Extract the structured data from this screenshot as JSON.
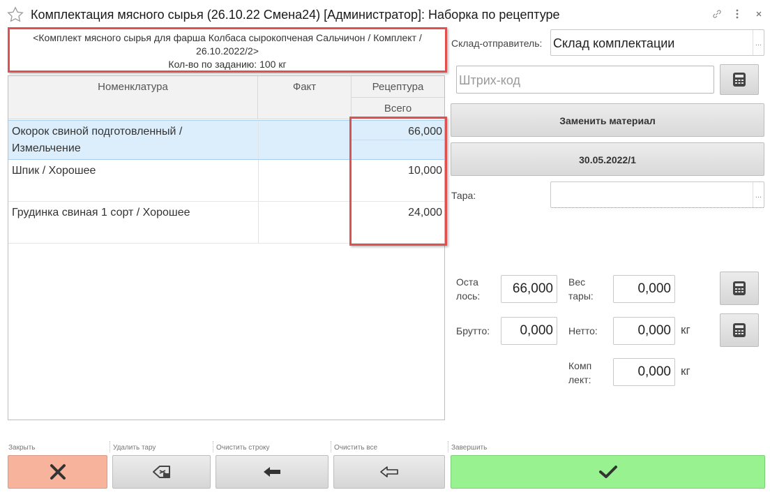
{
  "window": {
    "title": "Комплектация мясного сырья (26.10.22 Смена24) [Администратор]: Наборка по рецептуре",
    "favorite_icon": "star-icon",
    "link_icon": "link-icon",
    "more_icon": "more-vertical-icon",
    "close_icon": "close-icon"
  },
  "header": {
    "line1": "<Комплект мясного сырья для фарша Колбаса сырокопченая Сальчичон / Комплект /",
    "line2": "26.10.2022/2>",
    "line3": "Кол-во по заданию: 100 кг"
  },
  "grid": {
    "columns": {
      "nomenclature": "Номенклатура",
      "fact": "Факт",
      "recipe": "Рецептура",
      "total": "Всего"
    },
    "rows": [
      {
        "name_line1": "Окорок свиной подготовленный /",
        "name_line2": "Измельчение",
        "fact": "",
        "total": "66,000",
        "selected": true
      },
      {
        "name_line1": "Шпик / Хорошее",
        "name_line2": "",
        "fact": "",
        "total": "10,000",
        "selected": false
      },
      {
        "name_line1": "Грудинка свиная 1 сорт / Хорошее",
        "name_line2": "",
        "fact": "",
        "total": "24,000",
        "selected": false
      }
    ]
  },
  "right": {
    "warehouse_label": "Склад-отправитель:",
    "warehouse_value": "Склад комплектации",
    "barcode_placeholder": "Штрих-код",
    "replace_material": "Заменить материал",
    "batch": "30.05.2022/1",
    "tara_label": "Тара:",
    "tara_value": "",
    "remaining_label_1": "Оста",
    "remaining_label_2": "лось:",
    "remaining_value": "66,000",
    "tare_weight_label_1": "Вес",
    "tare_weight_label_2": "тары:",
    "tare_weight_value": "0,000",
    "gross_label": "Брутто:",
    "gross_value": "0,000",
    "net_label": "Нетто:",
    "net_value": "0,000",
    "net_unit": "кг",
    "kit_label_1": "Комп",
    "kit_label_2": "лект:",
    "kit_value": "0,000",
    "kit_unit": "кг"
  },
  "bottom": {
    "close_label": "Закрыть",
    "delete_tara_label": "Удалить тару",
    "clear_row_label": "Очистить строку",
    "clear_all_label": "Очистить все",
    "finish_label": "Завершить"
  },
  "colors": {
    "highlight_border": "#e05050",
    "selected_row": "#dceefb",
    "close_button": "#f7b39b",
    "finish_button": "#98f290"
  }
}
